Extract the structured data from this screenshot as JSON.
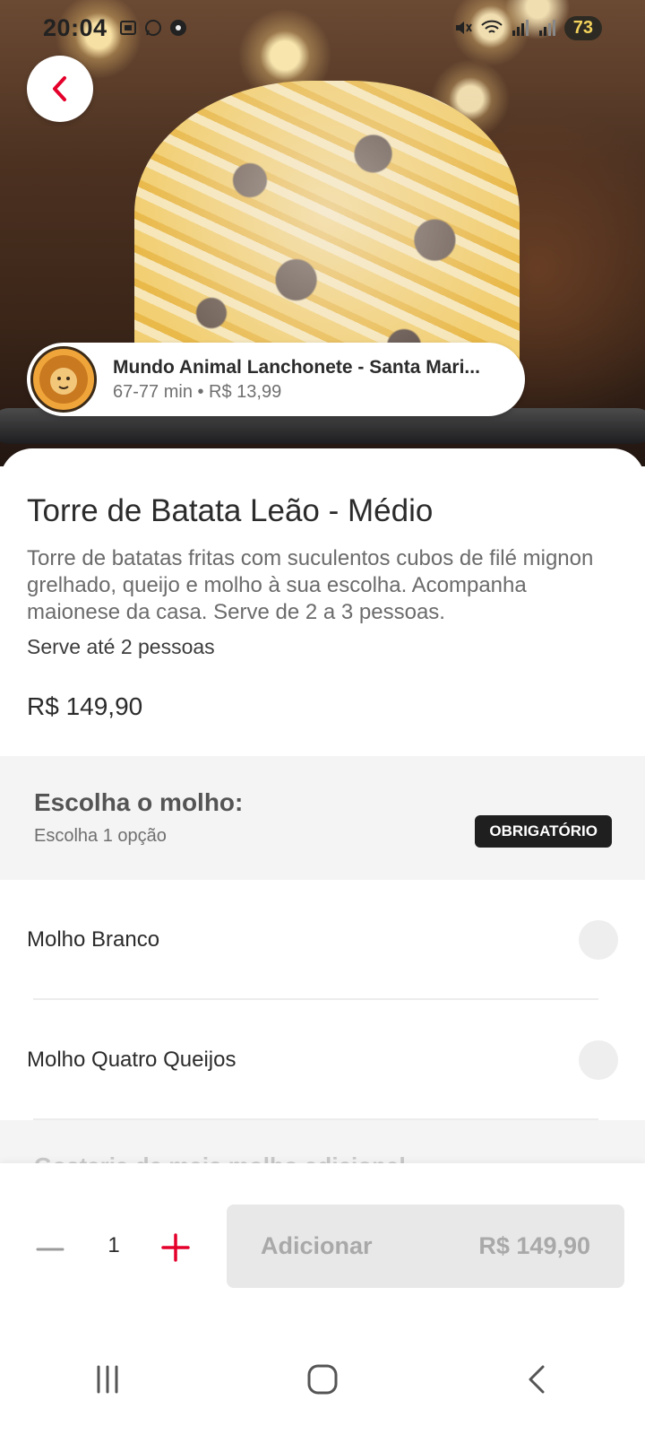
{
  "status_bar": {
    "time": "20:04",
    "battery": "73"
  },
  "store": {
    "name": "Mundo Animal Lanchonete - Santa Mari...",
    "meta": "67-77 min • R$ 13,99"
  },
  "product": {
    "title": "Torre de Batata Leão - Médio",
    "description": "Torre de batatas fritas com suculentos cubos de filé mignon grelhado, queijo e molho à sua escolha. Acompanha maionese da casa. Serve de 2 a 3 pessoas.",
    "serves": "Serve até 2 pessoas",
    "price": "R$ 149,90"
  },
  "option_group": {
    "title": "Escolha o molho:",
    "subtitle": "Escolha 1 opção",
    "badge": "OBRIGATÓRIO",
    "options": [
      {
        "label": "Molho Branco",
        "selected": false
      },
      {
        "label": "Molho Quatro Queijos",
        "selected": false
      }
    ]
  },
  "next_group": {
    "title_partial": "Gostaria de mais molho adicional"
  },
  "cart": {
    "quantity": "1",
    "add_label": "Adicionar",
    "total": "R$ 149,90"
  },
  "colors": {
    "accent": "#e4002b",
    "badge_bg": "#1f1f1f",
    "disabled_btn": "#e8e8e8"
  },
  "icons": {
    "back": "chevron-left-icon",
    "minus": "minus-icon",
    "plus": "plus-icon",
    "nav_recents": "recents-icon",
    "nav_home": "home-icon",
    "nav_back": "back-icon"
  }
}
